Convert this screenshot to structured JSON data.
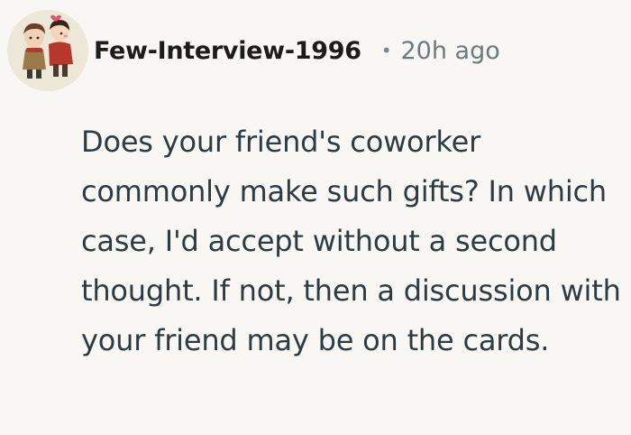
{
  "comment": {
    "author": "Few-Interview-1996",
    "separator": "•",
    "timestamp": "20h ago",
    "avatar_icon": "couple-avatar-icon",
    "body": "Does your friend's coworker commonly make such gifts? In which case, I'd accept without a second thought. If not, then a discussion with your friend may be on the cards."
  }
}
